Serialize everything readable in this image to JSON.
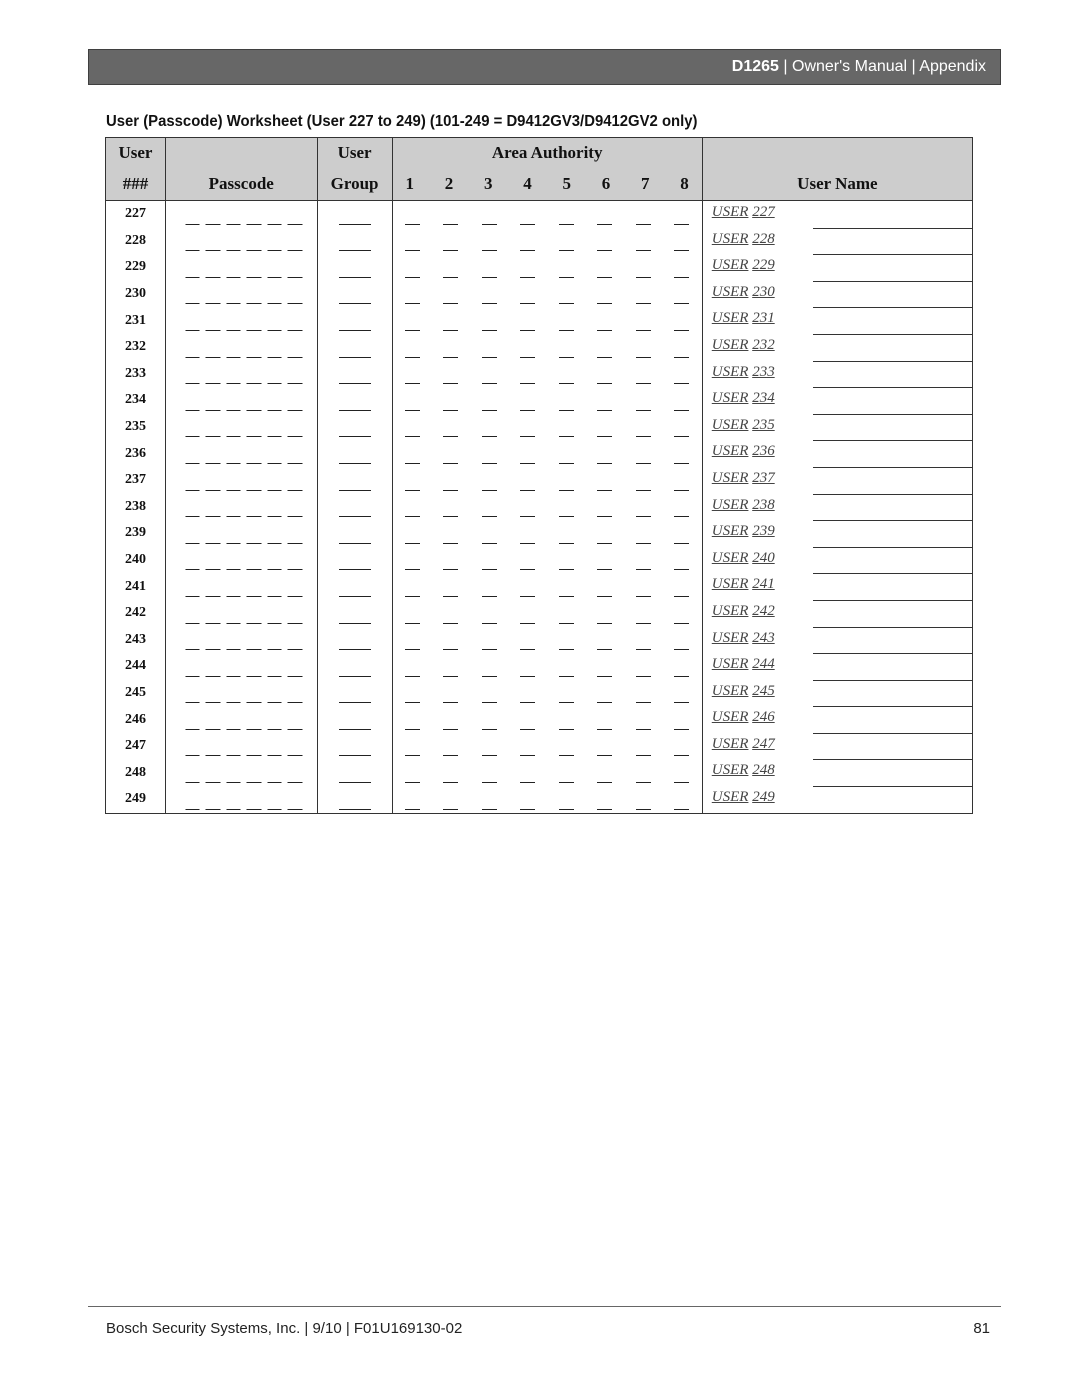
{
  "header": {
    "product": "D1265",
    "sep1": " | ",
    "manual": "Owner's Manual",
    "sep2": " | ",
    "section": "Appendix"
  },
  "title": "User (Passcode) Worksheet (User 227 to 249) (101-249 = D9412GV3/D9412GV2 only)",
  "table": {
    "headers": {
      "user_top": "User",
      "user_bottom": "###",
      "passcode": "Passcode",
      "group_top": "User",
      "group_bottom": "Group",
      "area_authority": "Area Authority",
      "areas": [
        "1",
        "2",
        "3",
        "4",
        "5",
        "6",
        "7",
        "8"
      ],
      "user_name": "User Name"
    },
    "rows": [
      {
        "num": "227",
        "name_prefix": "USER",
        "name_num": "227"
      },
      {
        "num": "228",
        "name_prefix": "USER",
        "name_num": "228"
      },
      {
        "num": "229",
        "name_prefix": "USER",
        "name_num": "229"
      },
      {
        "num": "230",
        "name_prefix": "USER",
        "name_num": "230"
      },
      {
        "num": "231",
        "name_prefix": "USER",
        "name_num": "231"
      },
      {
        "num": "232",
        "name_prefix": "USER",
        "name_num": "232"
      },
      {
        "num": "233",
        "name_prefix": "USER",
        "name_num": "233"
      },
      {
        "num": "234",
        "name_prefix": "USER",
        "name_num": "234"
      },
      {
        "num": "235",
        "name_prefix": "USER",
        "name_num": "235"
      },
      {
        "num": "236",
        "name_prefix": "USER",
        "name_num": "236"
      },
      {
        "num": "237",
        "name_prefix": "USER",
        "name_num": "237"
      },
      {
        "num": "238",
        "name_prefix": "USER",
        "name_num": "238"
      },
      {
        "num": "239",
        "name_prefix": "USER",
        "name_num": "239"
      },
      {
        "num": "240",
        "name_prefix": "USER",
        "name_num": "240"
      },
      {
        "num": "241",
        "name_prefix": "USER",
        "name_num": "241"
      },
      {
        "num": "242",
        "name_prefix": "USER",
        "name_num": "242"
      },
      {
        "num": "243",
        "name_prefix": "USER",
        "name_num": "243"
      },
      {
        "num": "244",
        "name_prefix": "USER",
        "name_num": "244"
      },
      {
        "num": "245",
        "name_prefix": "USER",
        "name_num": "245"
      },
      {
        "num": "246",
        "name_prefix": "USER",
        "name_num": "246"
      },
      {
        "num": "247",
        "name_prefix": "USER",
        "name_num": "247"
      },
      {
        "num": "248",
        "name_prefix": "USER",
        "name_num": "248"
      },
      {
        "num": "249",
        "name_prefix": "USER",
        "name_num": "249"
      }
    ]
  },
  "footer": {
    "left": "Bosch Security Systems, Inc. | 9/10 | F01U169130-02",
    "page": "81"
  }
}
